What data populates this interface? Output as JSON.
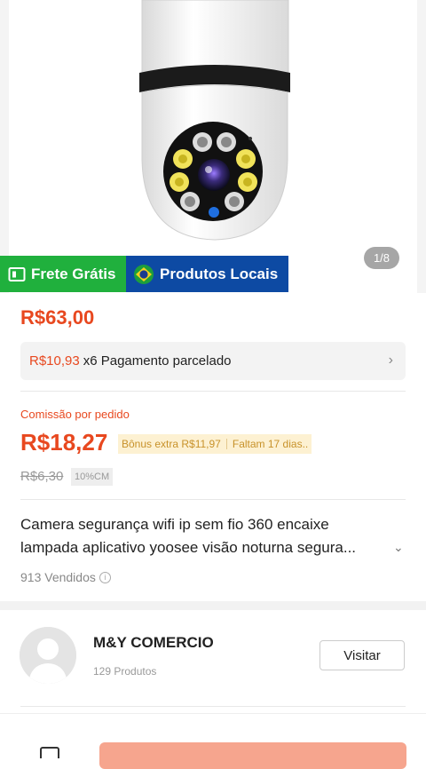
{
  "gallery": {
    "page_indicator": "1/8"
  },
  "badges": {
    "frete": "Frete Grátis",
    "locais": "Produtos Locais"
  },
  "price": "R$63,00",
  "installment": {
    "amount": "R$10,93",
    "text": "x6 Pagamento parcelado"
  },
  "commission": {
    "label": "Comissão por pedido",
    "value": "R$18,27",
    "bonus": "Bônus extra R$11,97",
    "deadline": "Faltam 17 dias..",
    "old_value": "R$6,30",
    "percent": "10%CM"
  },
  "product": {
    "title": "Camera segurança wifi ip sem fio 360 encaixe lampada aplicativo yoosee visão noturna segura...",
    "sold": "913 Vendidos"
  },
  "store": {
    "name": "M&Y COMERCIO",
    "count": "129 Produtos",
    "visit_label": "Visitar"
  },
  "colors": {
    "accent": "#e8481f",
    "frete_bg": "#20b03d",
    "locais_bg": "#0d4aa3",
    "bonus_bg": "#fdf1d2"
  }
}
